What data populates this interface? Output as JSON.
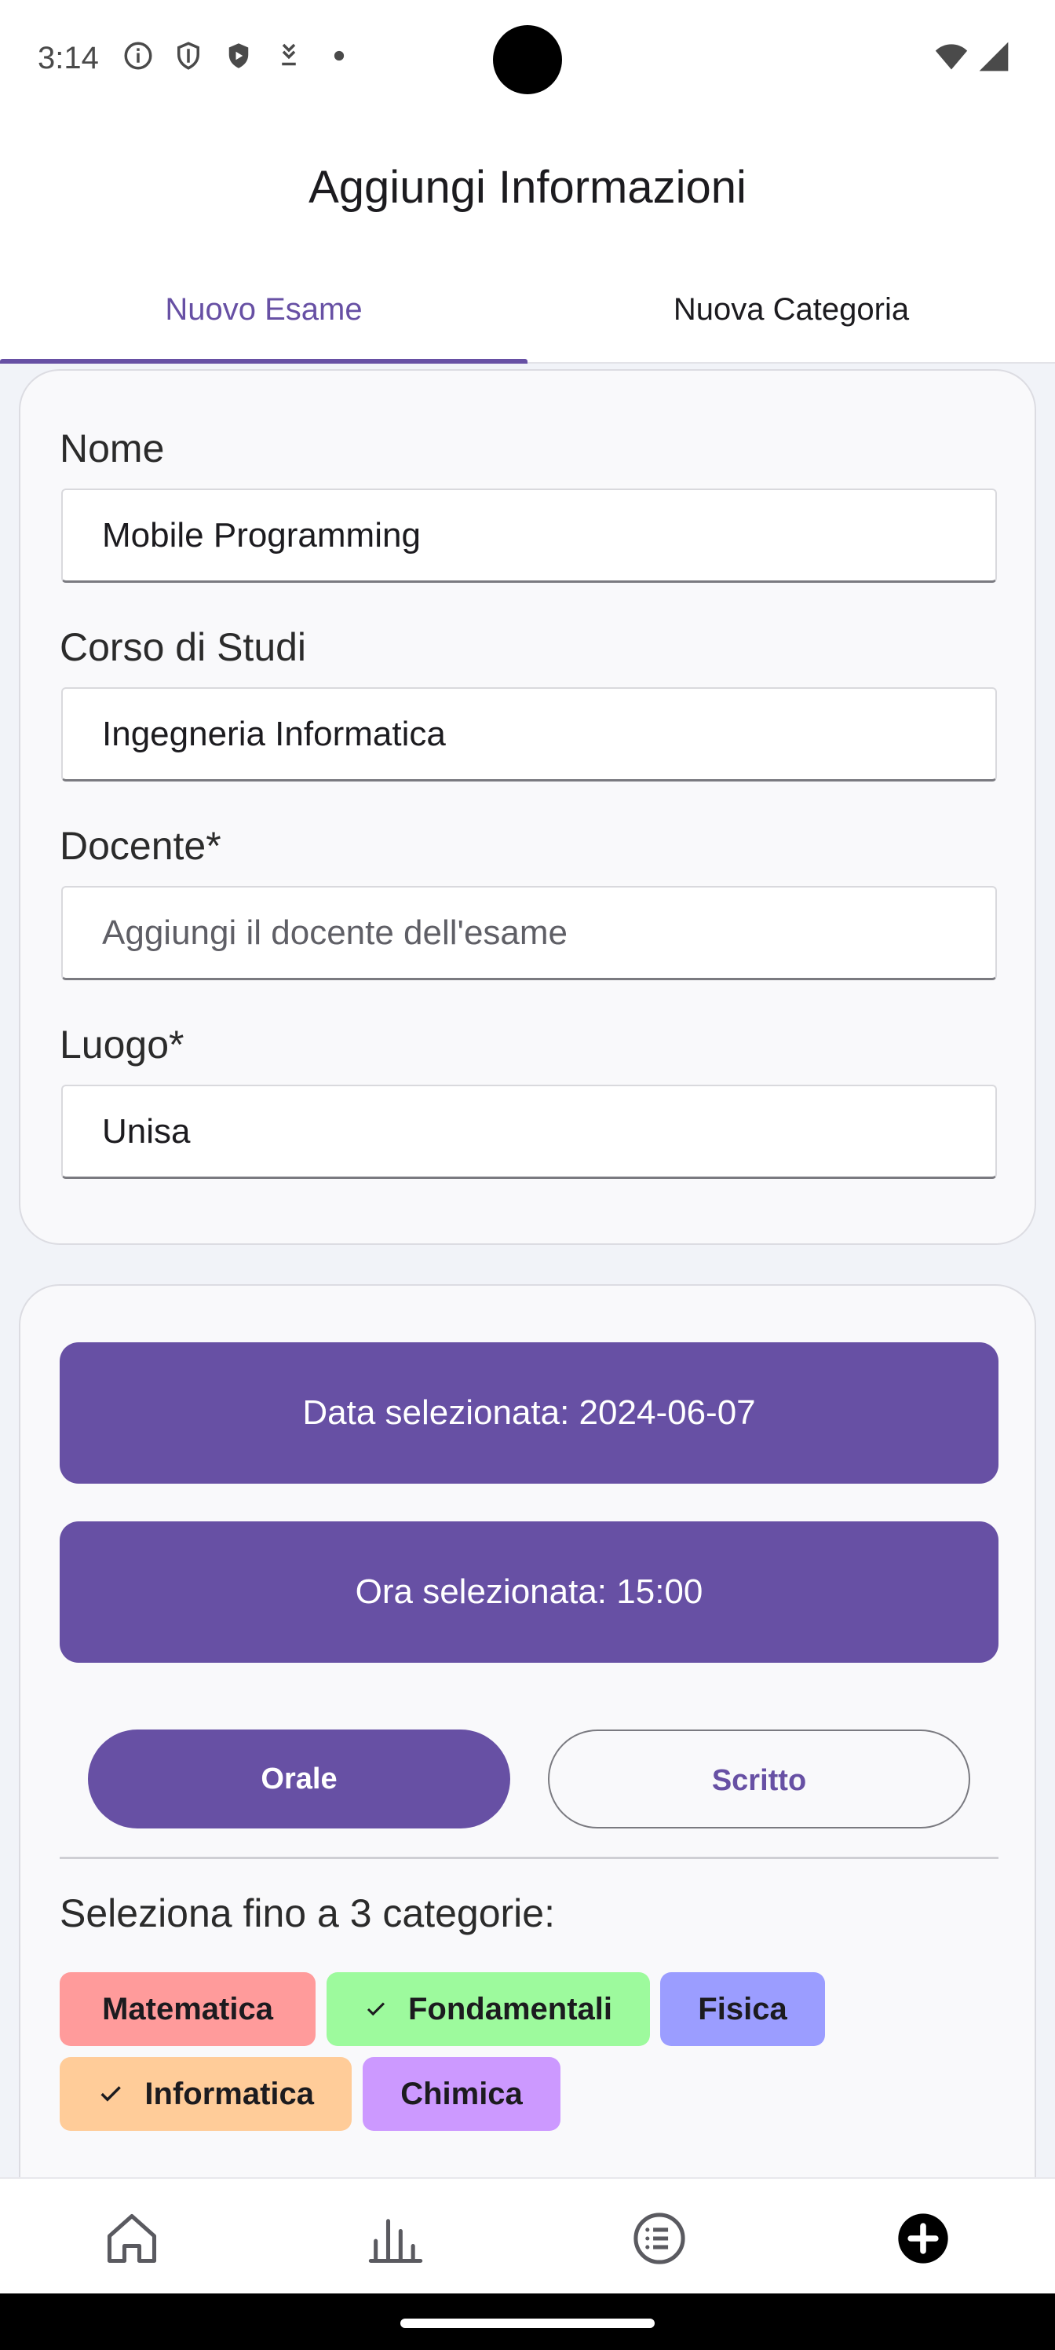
{
  "status_bar": {
    "time": "3:14",
    "icons": [
      "info-icon",
      "shield-icon",
      "play-shield-icon",
      "download-icon",
      "dot-icon"
    ],
    "right_icons": [
      "wifi-icon",
      "signal-icon"
    ]
  },
  "header": {
    "title": "Aggiungi Informazioni"
  },
  "tabs": [
    {
      "label": "Nuovo Esame",
      "active": true
    },
    {
      "label": "Nuova Categoria",
      "active": false
    }
  ],
  "form": {
    "nome": {
      "label": "Nome",
      "value": "Mobile Programming"
    },
    "corso": {
      "label": "Corso di Studi",
      "value": "Ingegneria Informatica"
    },
    "docente": {
      "label": "Docente*",
      "value": "",
      "placeholder": "Aggiungi il docente dell'esame"
    },
    "luogo": {
      "label": "Luogo*",
      "value": "Unisa"
    }
  },
  "schedule": {
    "date_label": "Data selezionata: 2024-06-07",
    "time_label": "Ora selezionata: 15:00",
    "type_options": [
      {
        "label": "Orale",
        "selected": true
      },
      {
        "label": "Scritto",
        "selected": false
      }
    ]
  },
  "categories": {
    "label": "Seleziona fino a 3 categorie:",
    "items": [
      {
        "label": "Matematica",
        "selected": false,
        "color": "#ff9b9b"
      },
      {
        "label": "Fondamentali",
        "selected": true,
        "color": "#9dfa9d"
      },
      {
        "label": "Fisica",
        "selected": false,
        "color": "#9b9dff"
      },
      {
        "label": "Informatica",
        "selected": true,
        "color": "#ffcc99"
      },
      {
        "label": "Chimica",
        "selected": false,
        "color": "#cc99ff"
      }
    ]
  },
  "bottom_nav": {
    "items": [
      "home-icon",
      "stats-icon",
      "list-icon",
      "add-icon"
    ],
    "active": "add-icon"
  },
  "colors": {
    "primary": "#6750a4",
    "surface": "#f9f9fb",
    "background": "#f1f3f8"
  }
}
